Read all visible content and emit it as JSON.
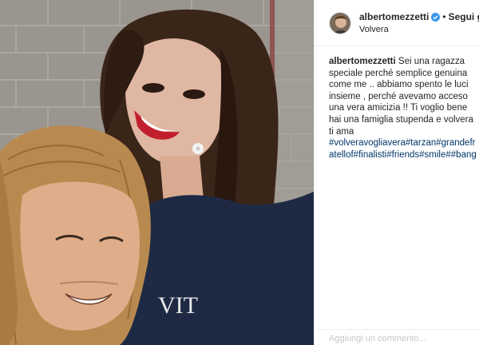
{
  "post": {
    "username": "albertomezzetti",
    "follow_label": "Segui già",
    "separator": "•",
    "location": "Volvera",
    "caption_username": "albertomezzetti",
    "caption_text": "Sei una ragazza speciale perché semplice genuina come me .. abbiamo spento le luci insieme , perché avevamo acceso una vera amicizia !! Ti voglio bene hai una famiglia stupenda e volvera ti ama",
    "hashtags": "#volveravogliavera#tarzan#grandefratellof#finalisti#friends#smile##bang",
    "comment_placeholder": "Aggiungi un commento..."
  },
  "colors": {
    "verified_badge": "#3897f0",
    "hashtag": "#003569",
    "border": "#efefef"
  },
  "icons": {
    "verified": "verified-badge-icon"
  },
  "photo": {
    "shirt_text": "VIT"
  }
}
